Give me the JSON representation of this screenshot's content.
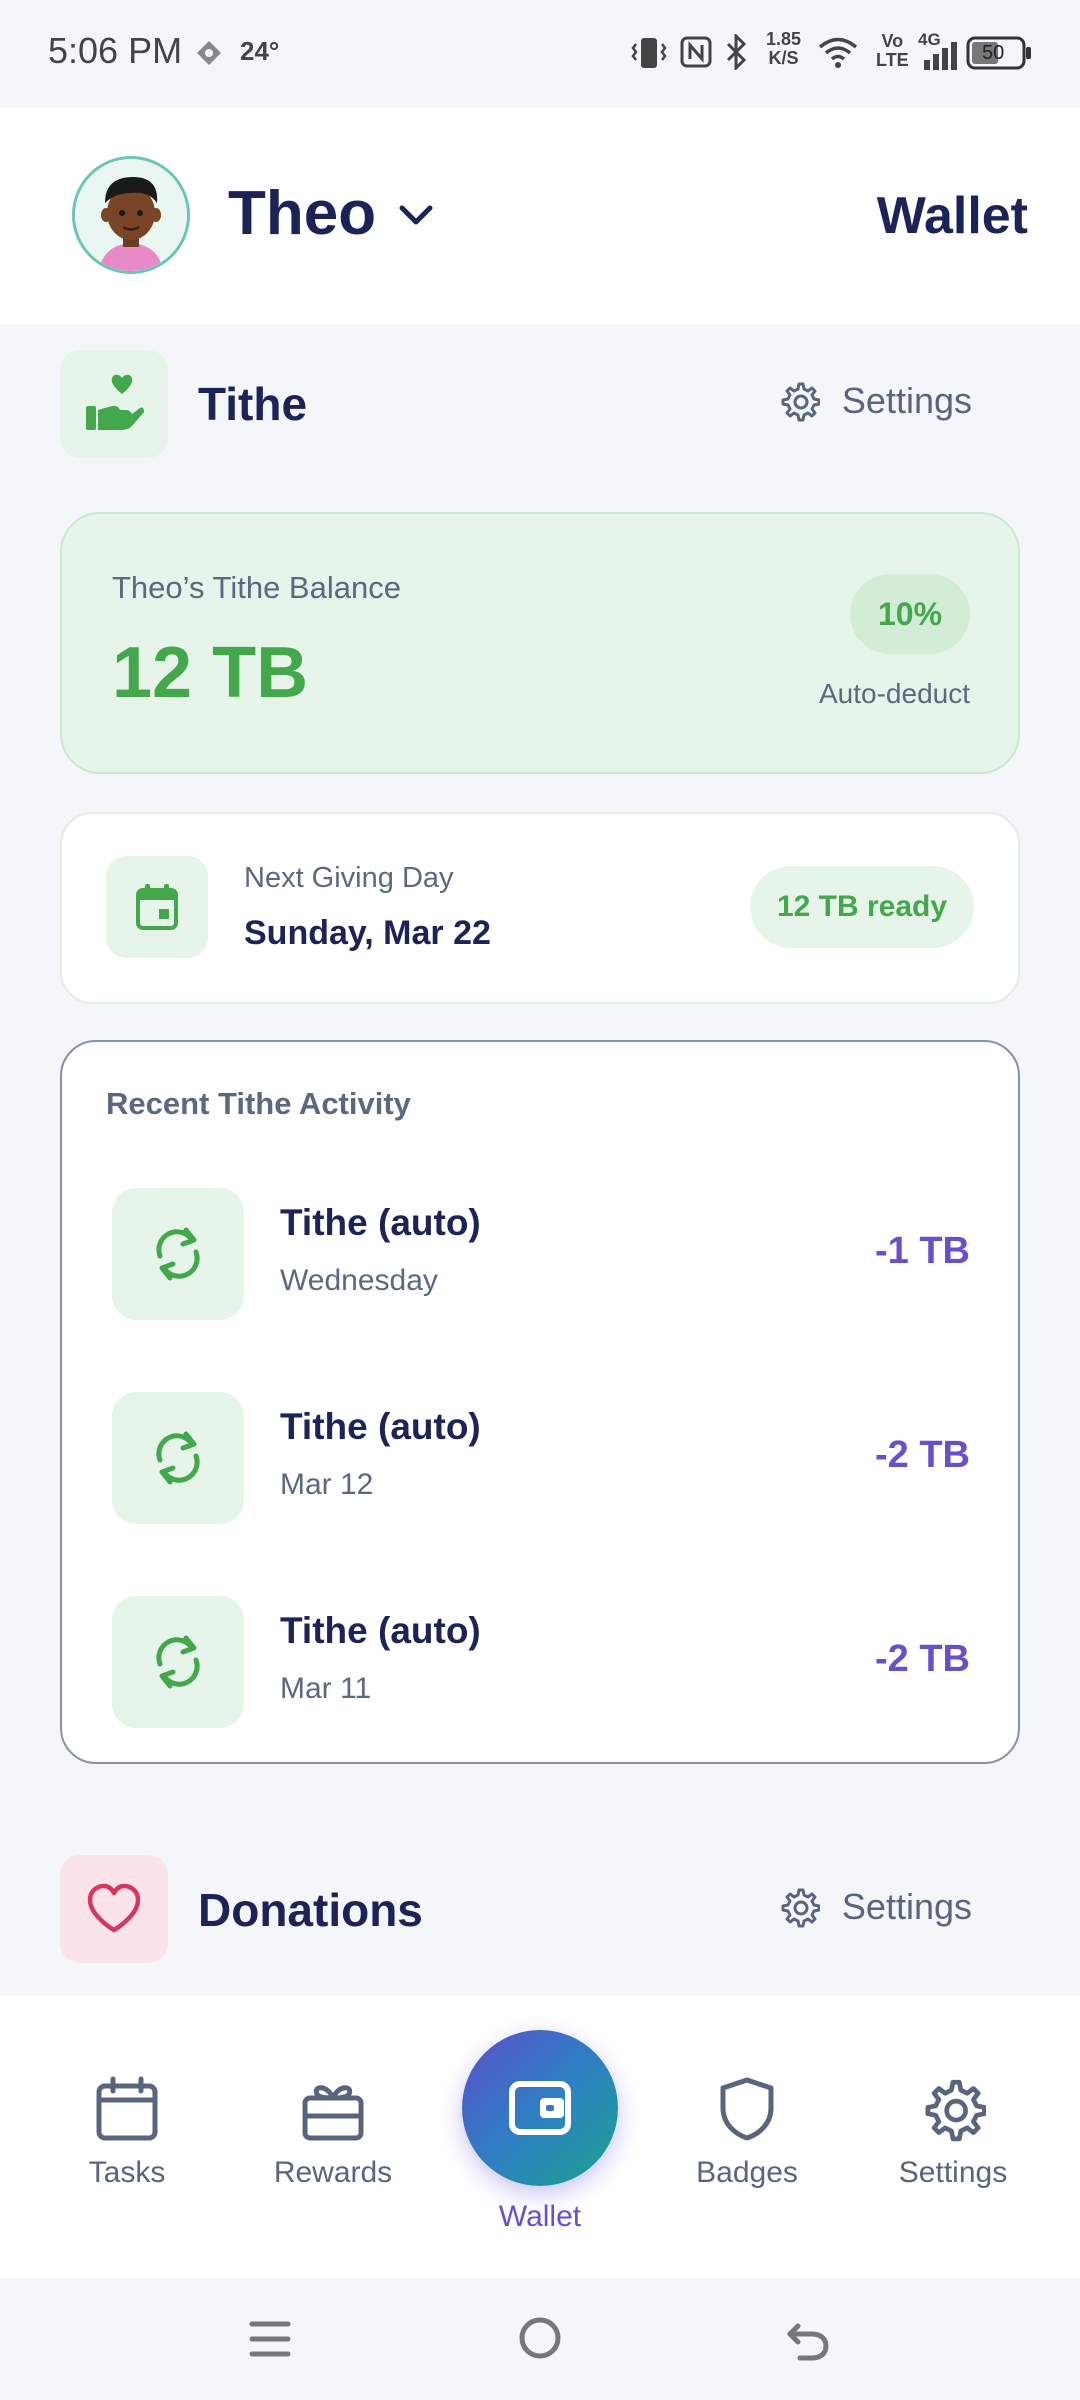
{
  "status_bar": {
    "time": "5:06 PM",
    "temperature": "24°",
    "net_speed_value": "1.85",
    "net_speed_unit": "K/S",
    "volte_top": "Vo",
    "volte_bottom": "LTE",
    "network_type": "4G",
    "battery": "50"
  },
  "header": {
    "child_name": "Theo",
    "page_title": "Wallet"
  },
  "tithe": {
    "title": "Tithe",
    "settings_label": "Settings",
    "balance_label": "Theo’s Tithe Balance",
    "balance_value": "12 TB",
    "deduct_percent": "10%",
    "deduct_label": "Auto-deduct",
    "next_giving_label": "Next Giving Day",
    "next_giving_date": "Sunday, Mar 22",
    "ready_label": "12 TB ready",
    "activity_heading": "Recent Tithe Activity",
    "activity": [
      {
        "title": "Tithe (auto)",
        "date": "Wednesday",
        "amount": "-1 TB"
      },
      {
        "title": "Tithe (auto)",
        "date": "Mar 12",
        "amount": "-2 TB"
      },
      {
        "title": "Tithe (auto)",
        "date": "Mar 11",
        "amount": "-2 TB"
      }
    ]
  },
  "donations": {
    "title": "Donations",
    "settings_label": "Settings"
  },
  "nav": {
    "tasks": "Tasks",
    "rewards": "Rewards",
    "wallet": "Wallet",
    "badges": "Badges",
    "settings": "Settings"
  },
  "colors": {
    "navy": "#1c2357",
    "green": "#43a84b",
    "purple": "#6a4fc9",
    "muted": "#59657e"
  }
}
